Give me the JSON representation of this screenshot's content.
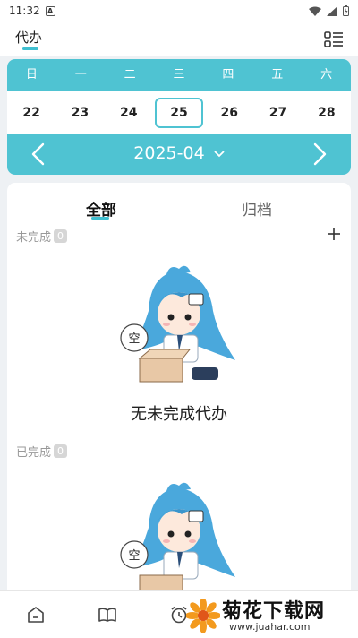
{
  "status_bar": {
    "time": "11:32",
    "a_glyph": "A"
  },
  "header": {
    "title": "代办"
  },
  "calendar": {
    "weekdays": [
      "日",
      "一",
      "二",
      "三",
      "四",
      "五",
      "六"
    ],
    "dates": [
      "22",
      "23",
      "24",
      "25",
      "26",
      "27",
      "28"
    ],
    "selected_date": "25",
    "month": "2025-04",
    "accent_color": "#4fc3d2"
  },
  "tabs": {
    "all": "全部",
    "archive": "归档"
  },
  "sections": {
    "incomplete": {
      "label": "未完成",
      "count": "0",
      "empty_text": "无未完成代办",
      "mascot_bubble": "空"
    },
    "completed": {
      "label": "已完成",
      "count": "0",
      "mascot_bubble": "空"
    }
  },
  "bottom_nav": {
    "items": [
      "home-icon",
      "book-icon",
      "alarm-icon"
    ]
  },
  "watermark": {
    "title": "菊花下载网",
    "url": "www.juahar.com"
  }
}
